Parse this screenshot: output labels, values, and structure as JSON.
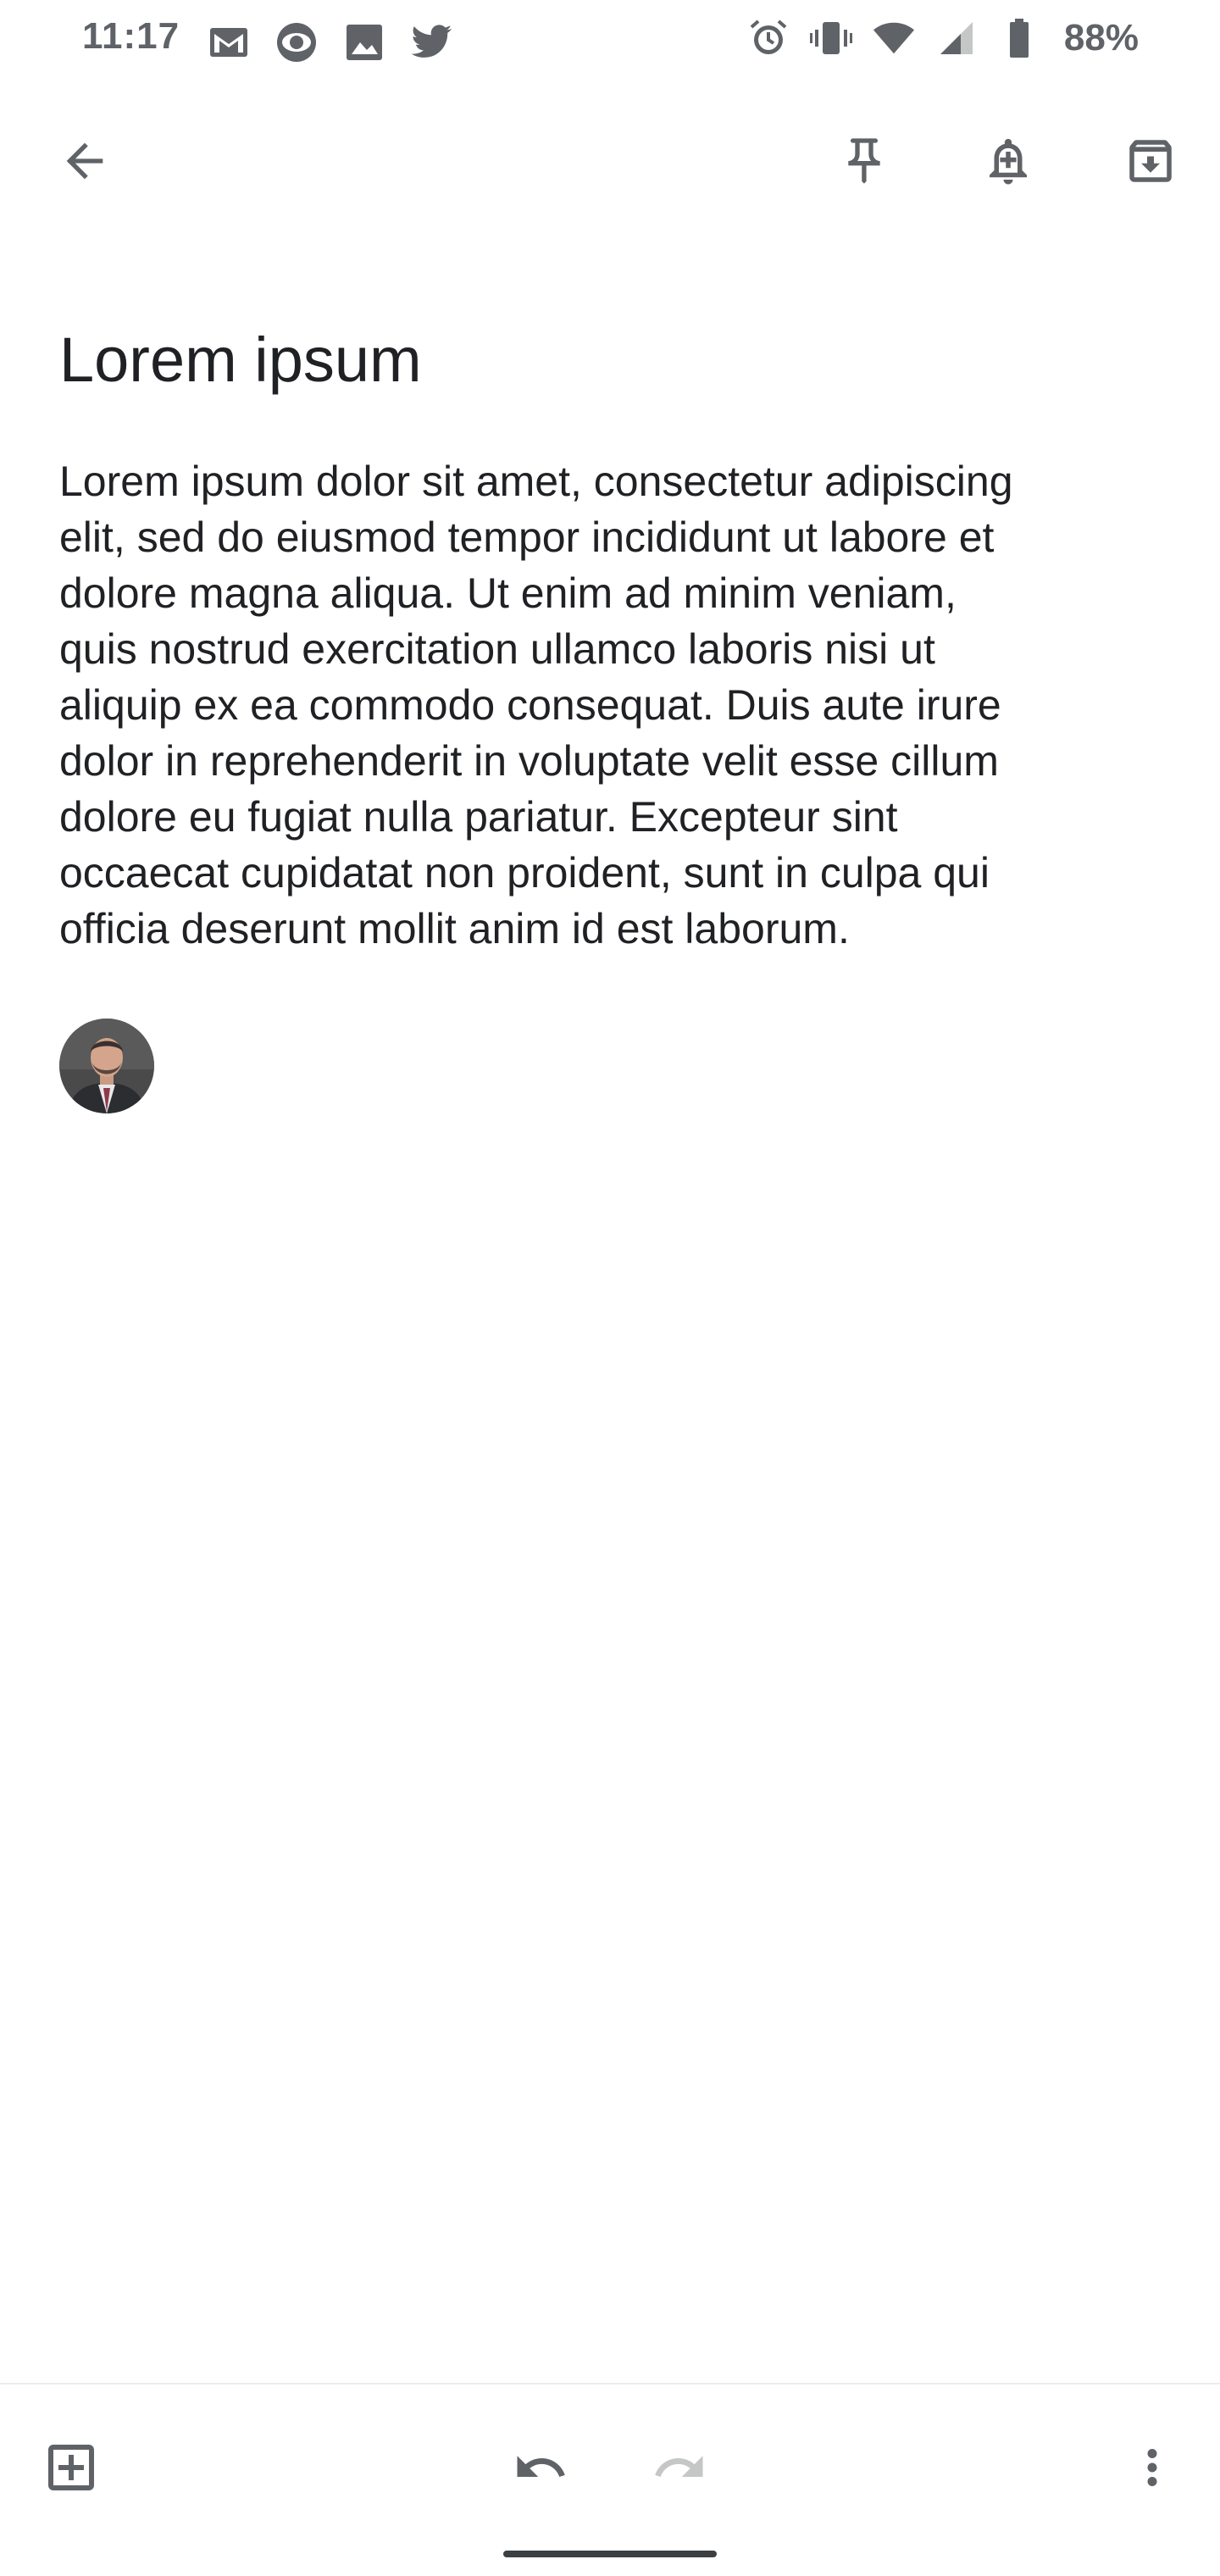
{
  "status_bar": {
    "time": "11:17",
    "battery_percent": "88%",
    "left_icons": [
      "gmail-icon",
      "eye-icon",
      "photos-icon",
      "twitter-icon"
    ],
    "right_icons": [
      "alarm-icon",
      "vibrate-icon",
      "wifi-icon",
      "signal-icon",
      "battery-icon"
    ]
  },
  "topbar": {
    "icons": [
      "back-arrow-icon",
      "pin-icon",
      "reminder-bell-icon",
      "archive-icon"
    ]
  },
  "note": {
    "title": "Lorem ipsum",
    "body": "Lorem ipsum dolor sit amet, consectetur adipiscing\nelit, sed do eiusmod tempor incididunt ut labore et\ndolore magna aliqua. Ut enim ad minim veniam,\nquis nostrud exercitation ullamco laboris nisi ut\naliquip ex ea commodo consequat. Duis aute irure\ndolor in reprehenderit in voluptate velit esse cillum\ndolore eu fugiat nulla pariatur. Excepteur sint\noccaecat cupidatat non proident, sunt in culpa qui\nofficia deserunt mollit anim id est laborum."
  },
  "bottom_bar": {
    "icons": [
      "add-box-icon",
      "undo-icon",
      "redo-icon",
      "more-vert-icon"
    ],
    "redo_enabled": false
  },
  "colors": {
    "icon": "#5f6368",
    "icon_disabled": "#c4c7c5",
    "text": "#202124"
  }
}
